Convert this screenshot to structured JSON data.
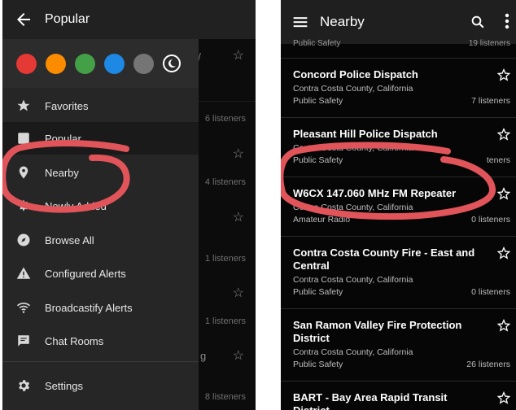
{
  "left": {
    "title": "Popular",
    "background_listeners": [
      "6 listeners",
      "4 listeners",
      "1 listeners",
      "1 listeners",
      "8 listeners"
    ],
    "background_fragments": [
      "g"
    ],
    "colors": [
      "#e53935",
      "#fb8c00",
      "#43a047",
      "#1e88e5",
      "#757575"
    ],
    "drawer": {
      "favorites": "Favorites",
      "popular": "Popular",
      "nearby": "Nearby",
      "recent": "Newly Added",
      "browse_all": "Browse All",
      "configured_alerts": "Configured Alerts",
      "broadcastify_alerts": "Broadcastify Alerts",
      "chat_rooms": "Chat Rooms",
      "settings": "Settings"
    }
  },
  "right": {
    "title": "Nearby",
    "partial_top": {
      "category": "Public Safety",
      "listeners": "19 listeners"
    },
    "feeds": [
      {
        "name": "Concord Police Dispatch",
        "location": "Contra Costa County, California",
        "category": "Public Safety",
        "listeners": "7 listeners"
      },
      {
        "name": "Pleasant Hill Police Dispatch",
        "location": "Contra Costa County, California",
        "category": "Public Safety",
        "listeners": "teners"
      },
      {
        "name": "W6CX 147.060 MHz FM Repeater",
        "location": "Contra Costa County, California",
        "category": "Amateur Radio",
        "listeners": "0 listeners"
      },
      {
        "name": "Contra Costa County Fire - East and Central",
        "location": "Contra Costa County, California",
        "category": "Public Safety",
        "listeners": "0 listeners"
      },
      {
        "name": "San Ramon Valley Fire Protection District",
        "location": "Contra Costa County, California",
        "category": "Public Safety",
        "listeners": "26 listeners"
      },
      {
        "name": "BART - Bay Area Rapid Transit District",
        "location": "",
        "category": "",
        "listeners": ""
      }
    ]
  },
  "annotation_color": "#e0545a"
}
